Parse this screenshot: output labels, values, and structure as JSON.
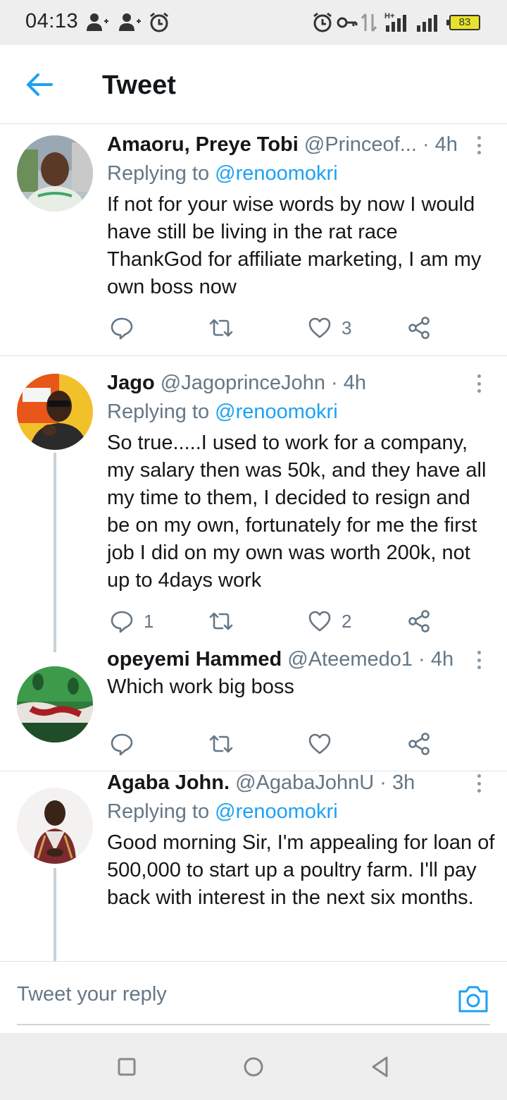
{
  "status_bar": {
    "time": "04:13",
    "battery": "83",
    "network": "H+"
  },
  "header": {
    "title": "Tweet"
  },
  "colors": {
    "accent": "#1da1f2",
    "text": "#14171a",
    "muted": "#657786",
    "divider": "#dfe3e6"
  },
  "tweets": [
    {
      "name": "Amaoru, Preye Tobi",
      "handle": "@Princeof...",
      "time": "· 4h",
      "replying_prefix": "Replying to",
      "replying_to": "@renoomokri",
      "text": "If not for your wise words by now I would have still be living in the rat race ThankGod for affiliate marketing, I am my own boss now",
      "reply_count": "",
      "retweet_count": "",
      "like_count": "3"
    },
    {
      "name": "Jago",
      "handle": "@JagoprinceJohn",
      "time": "· 4h",
      "replying_prefix": "Replying to",
      "replying_to": "@renoomokri",
      "text": "So true.....I used to work for a company, my salary then was 50k, and they have all my time to them, I decided to resign and be on my own, fortunately for me the first job I did on my own was worth 200k, not up to 4days work",
      "reply_count": "1",
      "retweet_count": "",
      "like_count": "2"
    },
    {
      "name": "opeyemi Hammed",
      "handle": "@Ateemedo1",
      "time": "· 4h",
      "text": "Which work big boss",
      "reply_count": "",
      "retweet_count": "",
      "like_count": ""
    },
    {
      "name": "Agaba John.",
      "handle": "@AgabaJohnU",
      "time": "· 3h",
      "replying_prefix": "Replying to",
      "replying_to": "@renoomokri",
      "text": "Good morning Sir, I'm appealing for loan of 500,000 to start up a poultry farm. I'll pay back with interest in the next six months."
    }
  ],
  "reply_bar": {
    "placeholder": "Tweet your reply"
  },
  "icons": {
    "back": "arrow-left-icon",
    "reply": "comment-icon",
    "retweet": "retweet-icon",
    "like": "heart-icon",
    "share": "share-icon",
    "more": "more-vertical-icon",
    "camera": "camera-icon"
  }
}
